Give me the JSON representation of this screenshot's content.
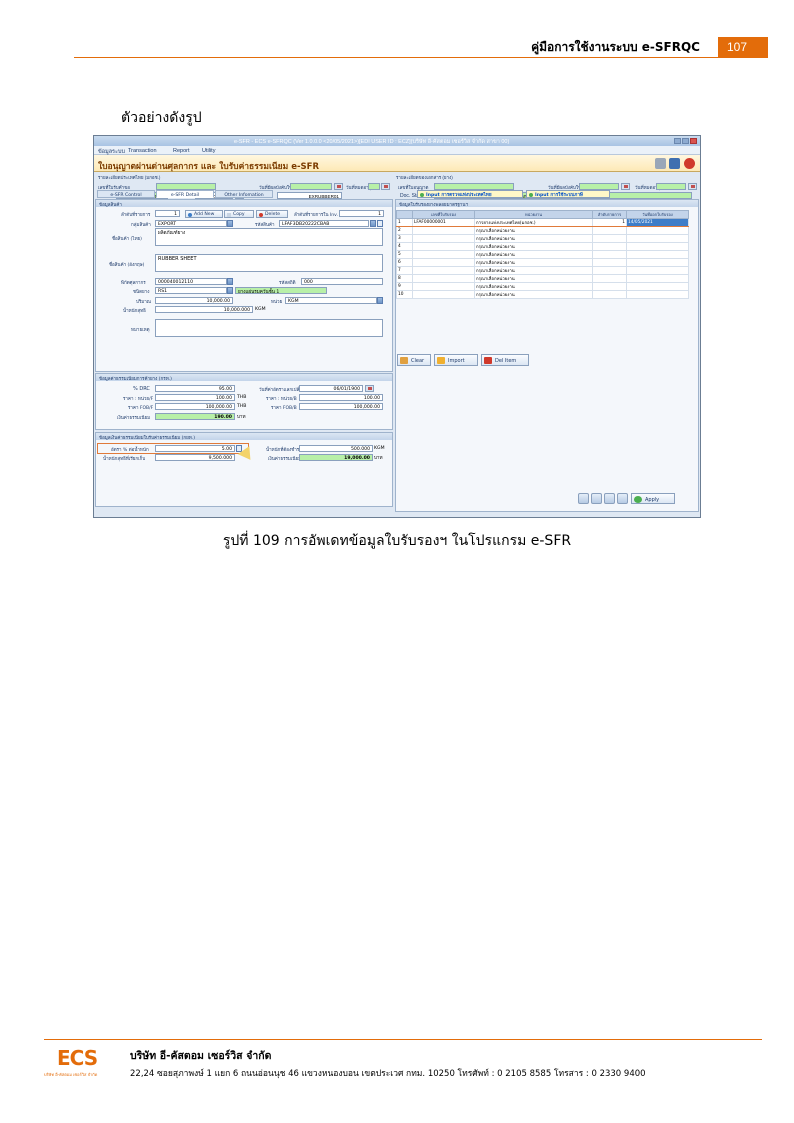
{
  "header": {
    "title": "คู่มือการใช้งานระบบ e-SFRQC",
    "page_number": "107",
    "accent_color": "#e36c0a"
  },
  "intro": "ตัวอย่างดังรูป",
  "app": {
    "window_title": "e-SFR - ECS e-SFRQC (Ver 1.0.0.0 <20/05/2021>)[EDI USER ID : ECZ](บริษัท อี-คัสตอม เซอร์วิส จำกัด สาขา 00)",
    "menu": [
      "ข้อมูลระบบ",
      "Transaction",
      "Report",
      "Utility"
    ],
    "form_title": "ใบอนุญาตผ่านด่านศุลกากร และ ใบรับค่าธรรมเนียม e-SFR",
    "left_header": {
      "section_title": "รายละเอียดประเทศไทย (มกอช.)",
      "labels": [
        "เลขที่ใบรับคำขอ",
        "วันที่มีผลบังคับใช้",
        "วันที่หมดอายุ"
      ],
      "ref_label": "Ref No.",
      "ref_no": "ADBCB00000063",
      "date_label": "วันที่เอกสาร",
      "date": "15/03/2021",
      "invoice_label": "InvoiceNo",
      "invoice_no": "EXRUBBER01"
    },
    "right_header": {
      "section_title": "รายละเอียดของเอกสาร (ยาง)",
      "labels": [
        "เลขที่ใบอนุญาต",
        "วันที่มีผลบังคับใช้",
        "วันที่หมดอายุ"
      ],
      "status_label": "Doc. Status",
      "status": "01 / WORKING PROCESS (ระหว่างดำเนินการ)"
    },
    "tabs": [
      "e-SFR Control",
      "e-SFR Detail",
      "Other Infomation"
    ],
    "link_buttons": [
      "Input การตรวจแห่งประเทศไทย",
      "Input การใช้ระบบภาษี"
    ],
    "product": {
      "section_title": "ข้อมูลสินค้า",
      "seq_label": "ลำดับที่รายการ",
      "seq": "1",
      "add_new": "Add New",
      "copy": "Copy",
      "delete": "Delete",
      "inv_seq_label": "ลำดับที่รายการใน Inv.",
      "inv_seq": "1",
      "group_label": "กลุ่มสินค้า",
      "group": "EXPORT",
      "code_label": "รหัสสินค้า",
      "code": "LFAF3DB20222CBAB",
      "name_th_label": "ชื่อสินค้า (ไทย)",
      "name_th": "ผลิตภัณฑ์ยาง",
      "name_en_label": "ชื่อสินค้า (อังกฤษ)",
      "name_en": "RUBBER SHEET",
      "tariff_label": "พิกัดศุลกากร",
      "tariff": "000040012110",
      "stat_label": "รหัสสถิติ",
      "stat": "000",
      "grade_label": "ชนิดยาง",
      "grade": "RS1",
      "grade_desc": "ยางแผ่นรมควันชั้น 1",
      "qty_label": "ปริมาณ",
      "qty": "10,000.00",
      "unit_label": "หน่วย",
      "unit": "KGM",
      "weight_label": "น้ำหนักสุทธิ",
      "weight": "10,000.000",
      "weight_unit": "KGM",
      "remark_label": "หมายเหตุ"
    },
    "value": {
      "section_title": "ข้อมูลค่าธรรมเนียมการค้ายาง (กรท.)",
      "drc_label": "% DRC",
      "drc": "95.00",
      "fx_date_label": "วันที่ค่าอัตราแลกเปลี่ยน",
      "fx_date": "06/01/1900",
      "price_f_label": "ราคา : หน่วย/F",
      "price_f": "100.00",
      "price_f_cur": "THB",
      "price_b_label": "ราคา : หน่วย/B",
      "price_b": "100.00",
      "fob_f_label": "ราคา FOB/F",
      "fob_f": "100,000.00",
      "fob_f_cur": "THB",
      "fob_b_label": "ราคา FOB/B",
      "fob_b": "100,000.00",
      "fee_label": "เงินค่าธรรมเนียม",
      "fee": "190.00",
      "fee_unit": "บาท"
    },
    "fund": {
      "section_title": "ข้อมูลเงินค่าธรรมเนียมใบรับค่าธรรมเนียม (กยท.)",
      "rate_label": "อัตรา % ต่อน้ำหนัก",
      "rate": "5.00",
      "weight_label": "น้ำหนักที่ต้องชำระ",
      "weight": "500.000",
      "weight_unit": "KGM",
      "net_label": "น้ำหนักสุทธิที่เรียกเก็บ",
      "net": "9,500.000",
      "fee_label": "เงินค่าธรรมเนียม",
      "fee": "19,000.00",
      "fee_unit": "บาท"
    },
    "grid": {
      "section_title": "ข้อมูลใบรับรองยางพลอยมาตรฐานฯ",
      "columns": [
        "",
        "เลขที่ใบรับรอง",
        "หน่วยงาน",
        "ลำดับรายการ",
        "วันที่ออกใบรับรอง"
      ],
      "rows": [
        {
          "no": "1",
          "cert": "LFAF00000001",
          "agency": "การยางแห่งประเทศไทย(มกอช.)",
          "seq": "1",
          "date": "14/05/2021"
        },
        {
          "no": "2",
          "cert": "",
          "agency": "กรุณาเลือกหน่วยงาน",
          "seq": "",
          "date": ""
        },
        {
          "no": "3",
          "cert": "",
          "agency": "กรุณาเลือกหน่วยงาน",
          "seq": "",
          "date": ""
        },
        {
          "no": "4",
          "cert": "",
          "agency": "กรุณาเลือกหน่วยงาน",
          "seq": "",
          "date": ""
        },
        {
          "no": "5",
          "cert": "",
          "agency": "กรุณาเลือกหน่วยงาน",
          "seq": "",
          "date": ""
        },
        {
          "no": "6",
          "cert": "",
          "agency": "กรุณาเลือกหน่วยงาน",
          "seq": "",
          "date": ""
        },
        {
          "no": "7",
          "cert": "",
          "agency": "กรุณาเลือกหน่วยงาน",
          "seq": "",
          "date": ""
        },
        {
          "no": "8",
          "cert": "",
          "agency": "กรุณาเลือกหน่วยงาน",
          "seq": "",
          "date": ""
        },
        {
          "no": "9",
          "cert": "",
          "agency": "กรุณาเลือกหน่วยงาน",
          "seq": "",
          "date": ""
        },
        {
          "no": "10",
          "cert": "",
          "agency": "กรุณาเลือกหน่วยงาน",
          "seq": "",
          "date": ""
        }
      ],
      "clear": "Clear",
      "import": "Import",
      "del_item": "Del Item",
      "apply": "Apply"
    }
  },
  "caption": "รูปที่ 109 การอัพเดทข้อมูลใบรับรองฯ ในโปรแกรม e-SFR",
  "footer": {
    "logo": "ECS",
    "logo_sub": "บริษัท อี-คัสตอม เซอร์วิส จำกัด",
    "company": "บริษัท อี-คัสตอม เซอร์วิส จำกัด",
    "address": "22,24 ซอยสุภาพงษ์ 1 แยก 6 ถนนอ่อนนุช 46 แขวงหนองบอน เขตประเวศ กทม. 10250 โทรศัพท์ : 0 2105 8585 โทรสาร : 0 2330 9400"
  }
}
